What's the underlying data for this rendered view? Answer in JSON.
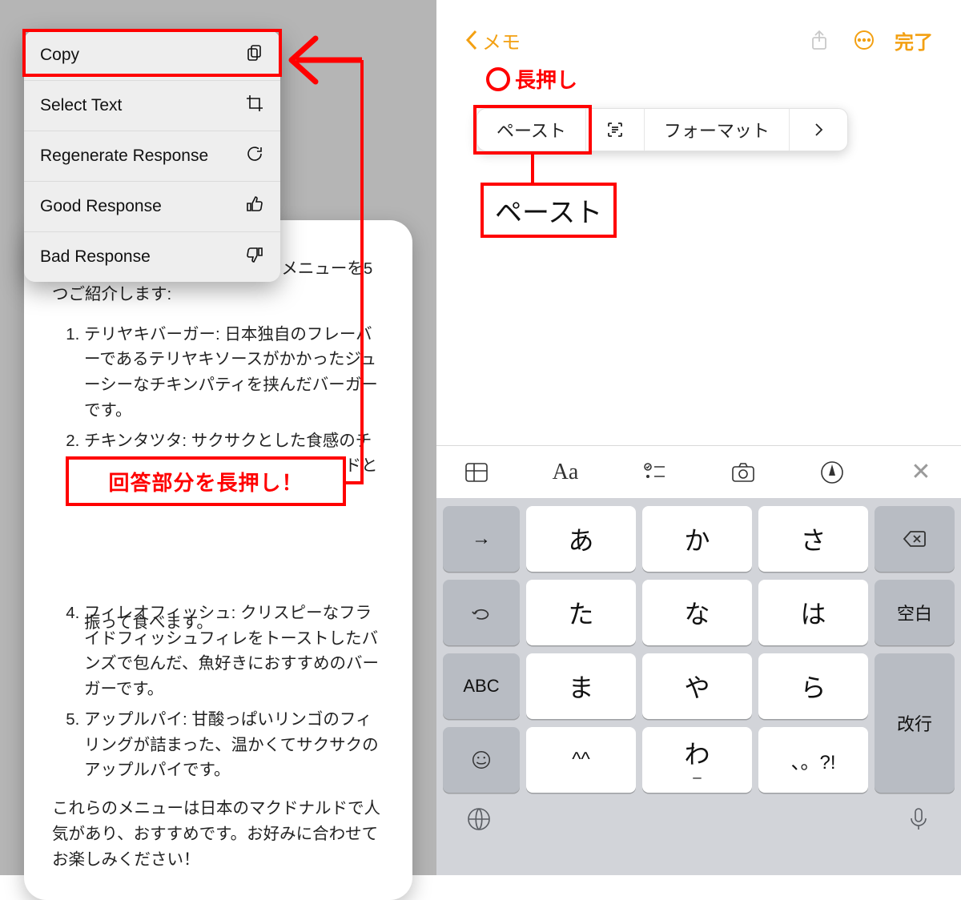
{
  "left_menu": {
    "copy": "Copy",
    "select_text": "Select Text",
    "regenerate": "Regenerate Response",
    "good": "Good Response",
    "bad": "Bad Response"
  },
  "card": {
    "intro_tail": "のメニューを5つご紹介します:",
    "items": [
      "テリヤキバーガー: 日本独自のフレーバーであるテリヤキソースがかかったジューシーなチキンパティを挟んだバーガーです。",
      "チキンタツタ: サクサクとした食感のチキンナゲットで、ソースやマスタードと一緒に楽しむ人気のメニューです。",
      "",
      "フィレオフィッシュ: クリスピーなフライドフィッシュフィレをトーストしたバンズで包んだ、魚好きにおすすめのバーガーです。",
      "アップルパイ: 甘酸っぱいリンゴのフィリングが詰まった、温かくてサクサクのアップルパイです。"
    ],
    "item3_tail": "振って食べます。",
    "outro": "これらのメニューは日本のマクドナルドで人気があり、おすすめです。お好みに合わせてお楽しみください！"
  },
  "callout": "回答部分を長押し！",
  "notes": {
    "back": "メモ",
    "done": "完了",
    "long_press": "長押し",
    "context": {
      "paste": "ペースト",
      "format": "フォーマット"
    },
    "paste_big": "ペースト"
  },
  "toolbar": {
    "aa": "Aa"
  },
  "keys": {
    "r1": [
      "あ",
      "か",
      "さ"
    ],
    "r2": [
      "た",
      "な",
      "は"
    ],
    "r3": [
      "ま",
      "や",
      "ら"
    ],
    "r4": [
      "^^",
      "わ",
      "、。?!"
    ],
    "tab_arrow": "→",
    "abc": "ABC",
    "space": "空白",
    "enter": "改行",
    "underscore": "_"
  }
}
